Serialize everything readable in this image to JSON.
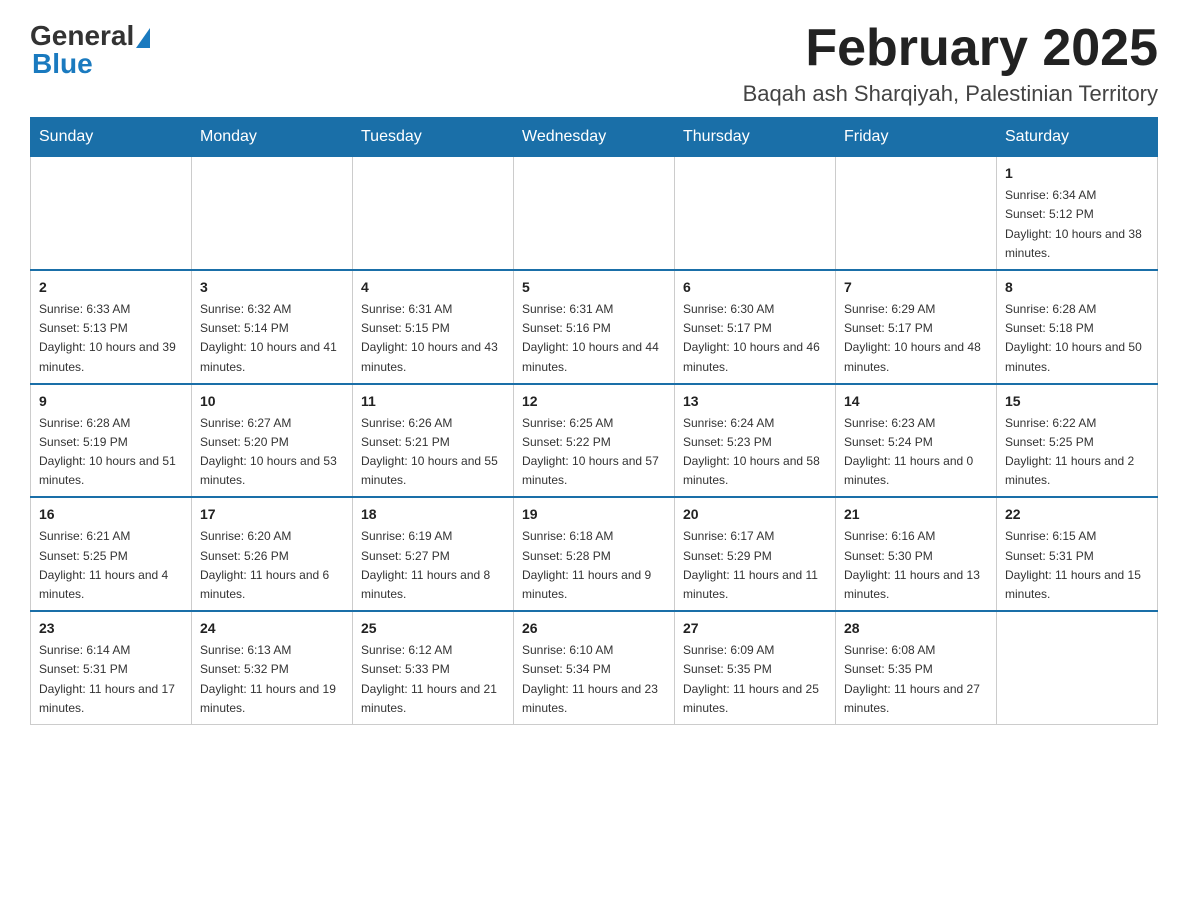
{
  "logo": {
    "general": "General",
    "blue": "Blue"
  },
  "title": "February 2025",
  "subtitle": "Baqah ash Sharqiyah, Palestinian Territory",
  "headers": [
    "Sunday",
    "Monday",
    "Tuesday",
    "Wednesday",
    "Thursday",
    "Friday",
    "Saturday"
  ],
  "weeks": [
    [
      {
        "day": "",
        "info": ""
      },
      {
        "day": "",
        "info": ""
      },
      {
        "day": "",
        "info": ""
      },
      {
        "day": "",
        "info": ""
      },
      {
        "day": "",
        "info": ""
      },
      {
        "day": "",
        "info": ""
      },
      {
        "day": "1",
        "info": "Sunrise: 6:34 AM\nSunset: 5:12 PM\nDaylight: 10 hours and 38 minutes."
      }
    ],
    [
      {
        "day": "2",
        "info": "Sunrise: 6:33 AM\nSunset: 5:13 PM\nDaylight: 10 hours and 39 minutes."
      },
      {
        "day": "3",
        "info": "Sunrise: 6:32 AM\nSunset: 5:14 PM\nDaylight: 10 hours and 41 minutes."
      },
      {
        "day": "4",
        "info": "Sunrise: 6:31 AM\nSunset: 5:15 PM\nDaylight: 10 hours and 43 minutes."
      },
      {
        "day": "5",
        "info": "Sunrise: 6:31 AM\nSunset: 5:16 PM\nDaylight: 10 hours and 44 minutes."
      },
      {
        "day": "6",
        "info": "Sunrise: 6:30 AM\nSunset: 5:17 PM\nDaylight: 10 hours and 46 minutes."
      },
      {
        "day": "7",
        "info": "Sunrise: 6:29 AM\nSunset: 5:17 PM\nDaylight: 10 hours and 48 minutes."
      },
      {
        "day": "8",
        "info": "Sunrise: 6:28 AM\nSunset: 5:18 PM\nDaylight: 10 hours and 50 minutes."
      }
    ],
    [
      {
        "day": "9",
        "info": "Sunrise: 6:28 AM\nSunset: 5:19 PM\nDaylight: 10 hours and 51 minutes."
      },
      {
        "day": "10",
        "info": "Sunrise: 6:27 AM\nSunset: 5:20 PM\nDaylight: 10 hours and 53 minutes."
      },
      {
        "day": "11",
        "info": "Sunrise: 6:26 AM\nSunset: 5:21 PM\nDaylight: 10 hours and 55 minutes."
      },
      {
        "day": "12",
        "info": "Sunrise: 6:25 AM\nSunset: 5:22 PM\nDaylight: 10 hours and 57 minutes."
      },
      {
        "day": "13",
        "info": "Sunrise: 6:24 AM\nSunset: 5:23 PM\nDaylight: 10 hours and 58 minutes."
      },
      {
        "day": "14",
        "info": "Sunrise: 6:23 AM\nSunset: 5:24 PM\nDaylight: 11 hours and 0 minutes."
      },
      {
        "day": "15",
        "info": "Sunrise: 6:22 AM\nSunset: 5:25 PM\nDaylight: 11 hours and 2 minutes."
      }
    ],
    [
      {
        "day": "16",
        "info": "Sunrise: 6:21 AM\nSunset: 5:25 PM\nDaylight: 11 hours and 4 minutes."
      },
      {
        "day": "17",
        "info": "Sunrise: 6:20 AM\nSunset: 5:26 PM\nDaylight: 11 hours and 6 minutes."
      },
      {
        "day": "18",
        "info": "Sunrise: 6:19 AM\nSunset: 5:27 PM\nDaylight: 11 hours and 8 minutes."
      },
      {
        "day": "19",
        "info": "Sunrise: 6:18 AM\nSunset: 5:28 PM\nDaylight: 11 hours and 9 minutes."
      },
      {
        "day": "20",
        "info": "Sunrise: 6:17 AM\nSunset: 5:29 PM\nDaylight: 11 hours and 11 minutes."
      },
      {
        "day": "21",
        "info": "Sunrise: 6:16 AM\nSunset: 5:30 PM\nDaylight: 11 hours and 13 minutes."
      },
      {
        "day": "22",
        "info": "Sunrise: 6:15 AM\nSunset: 5:31 PM\nDaylight: 11 hours and 15 minutes."
      }
    ],
    [
      {
        "day": "23",
        "info": "Sunrise: 6:14 AM\nSunset: 5:31 PM\nDaylight: 11 hours and 17 minutes."
      },
      {
        "day": "24",
        "info": "Sunrise: 6:13 AM\nSunset: 5:32 PM\nDaylight: 11 hours and 19 minutes."
      },
      {
        "day": "25",
        "info": "Sunrise: 6:12 AM\nSunset: 5:33 PM\nDaylight: 11 hours and 21 minutes."
      },
      {
        "day": "26",
        "info": "Sunrise: 6:10 AM\nSunset: 5:34 PM\nDaylight: 11 hours and 23 minutes."
      },
      {
        "day": "27",
        "info": "Sunrise: 6:09 AM\nSunset: 5:35 PM\nDaylight: 11 hours and 25 minutes."
      },
      {
        "day": "28",
        "info": "Sunrise: 6:08 AM\nSunset: 5:35 PM\nDaylight: 11 hours and 27 minutes."
      },
      {
        "day": "",
        "info": ""
      }
    ]
  ]
}
